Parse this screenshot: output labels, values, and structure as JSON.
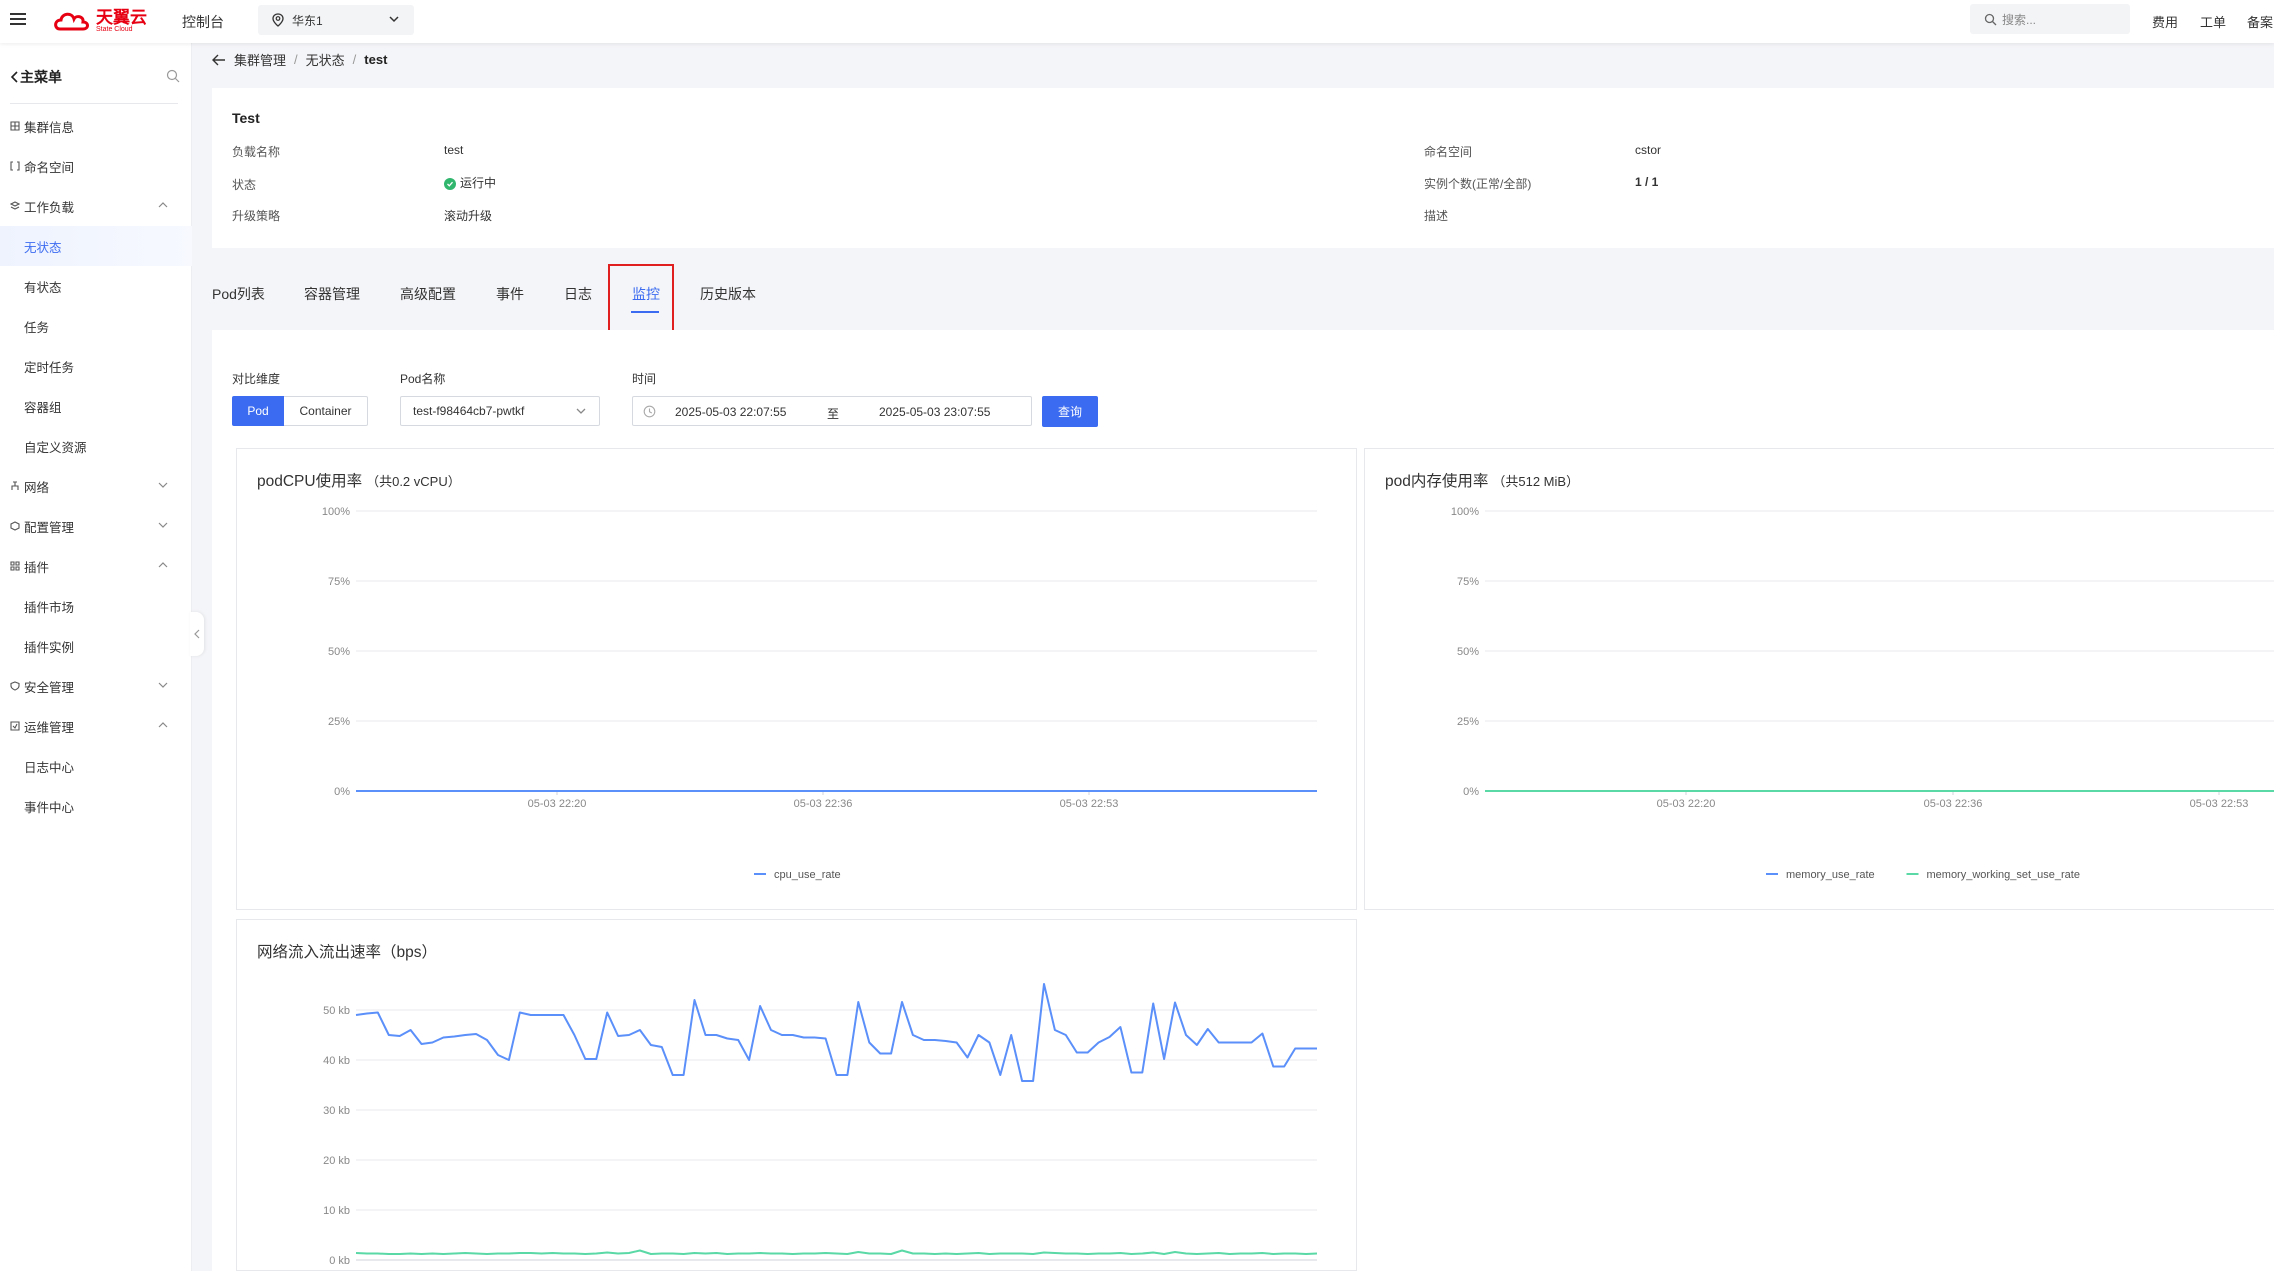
{
  "topbar": {
    "logo_name": "天翼云",
    "logo_sub": "State Cloud",
    "console": "控制台",
    "region": "华东1",
    "search_placeholder": "搜索...",
    "links": [
      "费用",
      "工单",
      "备案"
    ]
  },
  "sidebar": {
    "title": "主菜单",
    "items": [
      {
        "label": "集群信息",
        "type": "top"
      },
      {
        "label": "命名空间",
        "type": "top"
      },
      {
        "label": "工作负载",
        "type": "top",
        "arrow": "up"
      },
      {
        "label": "无状态",
        "type": "sub",
        "active": true
      },
      {
        "label": "有状态",
        "type": "sub"
      },
      {
        "label": "任务",
        "type": "sub"
      },
      {
        "label": "定时任务",
        "type": "sub"
      },
      {
        "label": "容器组",
        "type": "sub"
      },
      {
        "label": "自定义资源",
        "type": "sub"
      },
      {
        "label": "网络",
        "type": "top",
        "arrow": "down"
      },
      {
        "label": "配置管理",
        "type": "top",
        "arrow": "down"
      },
      {
        "label": "插件",
        "type": "top",
        "arrow": "up"
      },
      {
        "label": "插件市场",
        "type": "sub"
      },
      {
        "label": "插件实例",
        "type": "sub"
      },
      {
        "label": "安全管理",
        "type": "top",
        "arrow": "down"
      },
      {
        "label": "运维管理",
        "type": "top",
        "arrow": "up"
      },
      {
        "label": "日志中心",
        "type": "sub"
      },
      {
        "label": "事件中心",
        "type": "sub"
      }
    ]
  },
  "breadcrumb": {
    "items": [
      "集群管理",
      "无状态"
    ],
    "current": "test"
  },
  "info": {
    "title": "Test",
    "workload_name_label": "负载名称",
    "workload_name": "test",
    "status_label": "状态",
    "status": "运行中",
    "upgrade_label": "升级策略",
    "upgrade": "滚动升级",
    "namespace_label": "命名空间",
    "namespace": "cstor",
    "instances_label": "实例个数(正常/全部)",
    "instances": "1 / 1",
    "desc_label": "描述",
    "desc": ""
  },
  "tabs": [
    "Pod列表",
    "容器管理",
    "高级配置",
    "事件",
    "日志",
    "监控",
    "历史版本"
  ],
  "active_tab": "监控",
  "filters": {
    "dimension_label": "对比维度",
    "dimension_options": [
      "Pod",
      "Container"
    ],
    "dimension_selected": "Pod",
    "pod_label": "Pod名称",
    "pod_value": "test-f98464cb7-pwtkf",
    "time_label": "时间",
    "time_start": "2025-05-03 22:07:55",
    "time_sep": "至",
    "time_end": "2025-05-03 23:07:55",
    "query": "查询"
  },
  "chart_data": [
    {
      "type": "line",
      "title": "podCPU使用率",
      "subtitle": "（共0.2 vCPU）",
      "y_ticks": [
        "100%",
        "75%",
        "50%",
        "25%",
        "0%"
      ],
      "x_ticks": [
        "05-03 22:20",
        "05-03 22:36",
        "05-03 22:53"
      ],
      "ylim": [
        0,
        100
      ],
      "series": [
        {
          "name": "cpu_use_rate",
          "color": "#5b8ff9",
          "values": [
            0,
            0,
            0,
            0,
            0,
            0,
            0
          ]
        }
      ]
    },
    {
      "type": "line",
      "title": "pod内存使用率",
      "subtitle": "（共512 MiB）",
      "y_ticks": [
        "100%",
        "75%",
        "50%",
        "25%",
        "0%"
      ],
      "x_ticks": [
        "05-03 22:20",
        "05-03 22:36",
        "05-03 22:53"
      ],
      "ylim": [
        0,
        100
      ],
      "series": [
        {
          "name": "memory_use_rate",
          "color": "#5b8ff9",
          "values": [
            0,
            0,
            0,
            0,
            0,
            0,
            0
          ]
        },
        {
          "name": "memory_working_set_use_rate",
          "color": "#5ad8a6",
          "values": [
            0,
            0,
            0,
            0,
            0,
            0,
            0
          ]
        }
      ]
    },
    {
      "type": "line",
      "title": "网络流入流出速率（bps）",
      "y_ticks": [
        "50 kb",
        "40 kb",
        "30 kb",
        "20 kb",
        "10 kb",
        "0 kb"
      ],
      "ylim": [
        0,
        50
      ],
      "series": [
        {
          "color": "#5b8ff9",
          "values": [
            49,
            49.3,
            49.5,
            45,
            44.8,
            46,
            43.2,
            43.5,
            44.5,
            44.7,
            45,
            45.2,
            44,
            41,
            40,
            49.5,
            49,
            49,
            49,
            49,
            45,
            40.2,
            40.2,
            49.5,
            44.8,
            45,
            46,
            43,
            42.6,
            37,
            37,
            52,
            45,
            45,
            44.3,
            44,
            40,
            50.8,
            46,
            45,
            45,
            44.5,
            44.5,
            44.3,
            37,
            37,
            51.6,
            43.5,
            41.3,
            41.3,
            51.6,
            45,
            44,
            44,
            43.8,
            43.5,
            40.5,
            45,
            43.5,
            37,
            45,
            35.8,
            35.8,
            55.2,
            46,
            45,
            41.5,
            41.5,
            43.5,
            44.6,
            46.6,
            37.5,
            37.5,
            51.3,
            40.2,
            51.5,
            45,
            43,
            46.2,
            43.5,
            43.5,
            43.5,
            43.5,
            45.3,
            38.7,
            38.7,
            42.3,
            42.3,
            42.3
          ]
        },
        {
          "color": "#5ad8a6",
          "values": [
            1.4,
            1.3,
            1.3,
            1.2,
            1.2,
            1.3,
            1.2,
            1.3,
            1.2,
            1.3,
            1.4,
            1.3,
            1.2,
            1.3,
            1.3,
            1.4,
            1.4,
            1.3,
            1.4,
            1.3,
            1.3,
            1.2,
            1.3,
            1.5,
            1.3,
            1.4,
            1.9,
            1.2,
            1.3,
            1.3,
            1.2,
            1.4,
            1.3,
            1.4,
            1.2,
            1.3,
            1.3,
            1.4,
            1.3,
            1.3,
            1.2,
            1.3,
            1.3,
            1.4,
            1.3,
            1.2,
            1.6,
            1.3,
            1.3,
            1.2,
            1.9,
            1.3,
            1.3,
            1.2,
            1.3,
            1.2,
            1.3,
            1.4,
            1.2,
            1.3,
            1.3,
            1.3,
            1.2,
            1.5,
            1.4,
            1.3,
            1.3,
            1.2,
            1.3,
            1.3,
            1.4,
            1.2,
            1.3,
            1.5,
            1.2,
            1.6,
            1.3,
            1.2,
            1.3,
            1.4,
            1.2,
            1.3,
            1.3,
            1.4,
            1.2,
            1.3,
            1.3,
            1.2,
            1.3
          ]
        }
      ]
    }
  ]
}
